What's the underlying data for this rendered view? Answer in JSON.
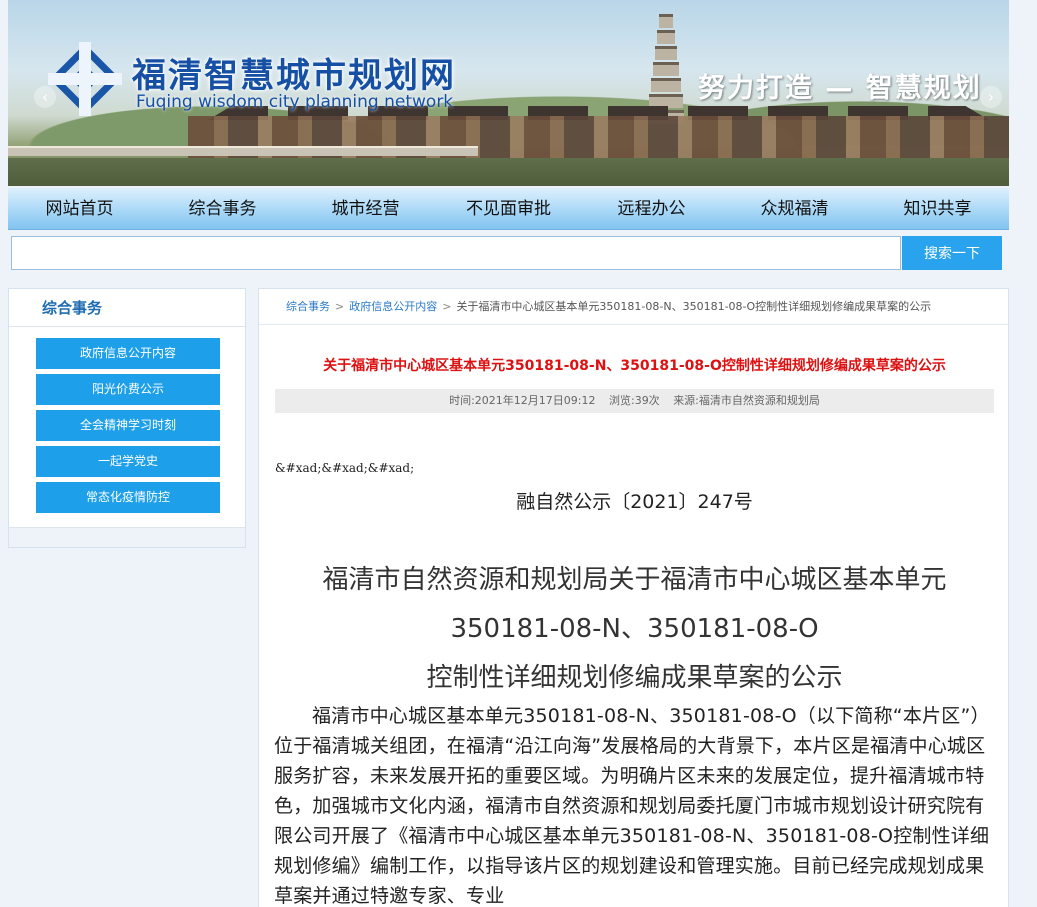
{
  "header": {
    "site_title": "福清智慧城市规划网",
    "site_subtitle": "Fuqing wisdom city planning network",
    "slogan": "努力打造 — 智慧规划"
  },
  "nav": {
    "items": [
      "网站首页",
      "综合事务",
      "城市经营",
      "不见面审批",
      "远程办公",
      "众规福清",
      "知识共享"
    ]
  },
  "search": {
    "value": "",
    "button_label": "搜索一下"
  },
  "sidebar": {
    "title": "综合事务",
    "items": [
      "政府信息公开内容",
      "阳光价费公示",
      "全会精神学习时刻",
      "一起学党史",
      "常态化疫情防控"
    ]
  },
  "breadcrumb": {
    "level1": "综合事务",
    "level2": "政府信息公开内容",
    "current": "关于福清市中心城区基本单元350181-08-N、350181-08-O控制性详细规划修编成果草案的公示",
    "separator": ">"
  },
  "article": {
    "title": "关于福清市中心城区基本单元350181-08-N、350181-08-O控制性详细规划修编成果草案的公示",
    "time": "时间:2021年12月17日09:12",
    "views": "浏览:39次",
    "source": "来源:福清市自然资源和规划局",
    "raw_entities": "&#xad;&#xad;&#xad;",
    "doc_number": "融自然公示〔2021〕247号",
    "heading_line1": "福清市自然资源和规划局关于福清市中心城区基本单元",
    "heading_line2": "350181-08-N、350181-08-O",
    "heading_line3": "控制性详细规划修编成果草案的公示",
    "body": "福清市中心城区基本单元350181-08-N、350181-08-O（以下简称“本片区”）位于福清城关组团，在福清“沿江向海”发展格局的大背景下，本片区是福清中心城区服务扩容，未来发展开拓的重要区域。为明确片区未来的发展定位，提升福清城市特色，加强城市文化内涵，福清市自然资源和规划局委托厦门市城市规划设计研究院有限公司开展了《福清市中心城区基本单元350181-08-N、350181-08-O控制性详细规划修编》编制工作，以指导该片区的规划建设和管理实施。目前已经完成规划成果草案并通过特邀专家、专业"
  }
}
